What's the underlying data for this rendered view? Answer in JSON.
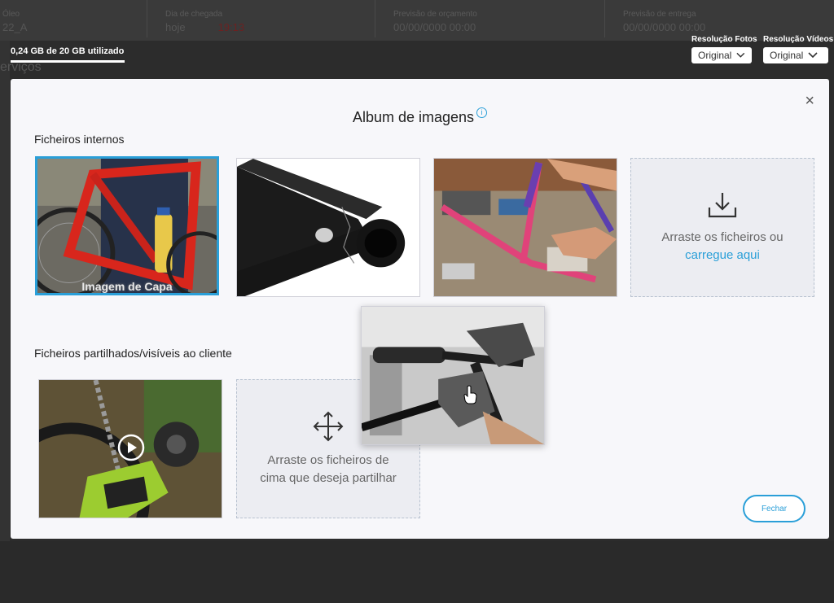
{
  "background": {
    "col1_label": "Óleo",
    "col1_value": "22_A",
    "col2_label": "Dia de chegada",
    "col2_value": "hoje",
    "col2_time": "19:13",
    "col3_label": "Previsão de orçamento",
    "col3_value": "00/00/0000 00:00",
    "col4_label": "Previsão de entrega",
    "col4_value": "00/00/0000 00:00",
    "faded_title": "erviços"
  },
  "storage": {
    "text": "0,24 GB de 20 GB utilizado",
    "used_fraction": 0.012
  },
  "resolution": {
    "photos_label": "Resolução Fotos",
    "photos_value": "Original",
    "videos_label": "Resolução Vídeos",
    "videos_value": "Original"
  },
  "modal": {
    "title": "Album de imagens",
    "info_icon": "i",
    "close_icon": "×",
    "internal_label": "Ficheiros internos",
    "cover_label": "Imagem de Capa",
    "upload_text": "Arraste os ficheiros ou",
    "upload_link": "carregue aqui",
    "shared_label": "Ficheiros partilhados/visíveis ao cliente",
    "share_drop_text": "Arraste os ficheiros de cima que deseja partilhar",
    "close_button": "Fechar"
  },
  "colors": {
    "accent": "#2a9fd8",
    "modal_bg": "#f7f7fa",
    "overlay": "#2c2c2c"
  }
}
